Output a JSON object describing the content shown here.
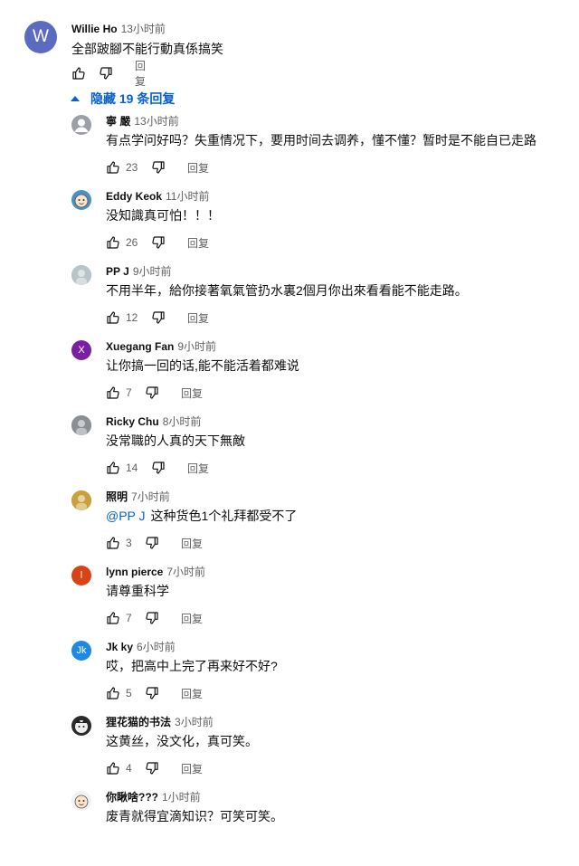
{
  "top_comment": {
    "avatar_letter": "W",
    "author": "Willie Ho",
    "time": "13小时前",
    "text": "全部跛腳不能行動真係搞笑",
    "reply_label": "回复"
  },
  "replies_toggle": "隐藏 19 条回复",
  "replies": [
    {
      "author": "寧 嚴",
      "time": "13小时前",
      "text": "有点学问好吗？失重情况下，要用时间去调养，懂不懂？暂时是不能自已走路",
      "likes": "23",
      "reply_label": "回复",
      "avatar": "default-person-avatar",
      "avatar_color": "#9aa0a6"
    },
    {
      "author": "Eddy Keok",
      "time": "11小时前",
      "text": "没知識真可怕！！！",
      "likes": "26",
      "reply_label": "回复",
      "avatar": "cartoon-face-avatar",
      "avatar_color": "#4a90c2"
    },
    {
      "author": "PP J",
      "time": "9小时前",
      "text": "不用半年，給你接著氧氣管扔水裏2個月你出來看看能不能走路。",
      "likes": "12",
      "reply_label": "回复",
      "avatar": "photo-avatar",
      "avatar_color": "#b8c4c8"
    },
    {
      "author": "Xuegang Fan",
      "time": "9小时前",
      "text": "让你搞一回的话,能不能活着都难说",
      "likes": "7",
      "reply_label": "回复",
      "avatar_letter": "X",
      "avatar_color": "#7b1fa2"
    },
    {
      "author": "Ricky Chu",
      "time": "8小时前",
      "text": "没常職的人真的天下無敵",
      "likes": "14",
      "reply_label": "回复",
      "avatar": "photo-avatar",
      "avatar_color": "#8a8f94"
    },
    {
      "author": "照明",
      "time": "7小时前",
      "mention": "@PP J",
      "text": "这种货色1个礼拜都受不了",
      "likes": "3",
      "reply_label": "回复",
      "avatar": "photo-avatar",
      "avatar_color": "#c9a13a"
    },
    {
      "author": "lynn pierce",
      "time": "7小时前",
      "text": "请尊重科学",
      "likes": "7",
      "reply_label": "回复",
      "avatar_letter": "l",
      "avatar_color": "#d84315"
    },
    {
      "author": "Jk ky",
      "time": "6小时前",
      "text": "哎，把高中上完了再来好不好?",
      "likes": "5",
      "reply_label": "回复",
      "avatar_letter": "Jk",
      "avatar_color": "#1e88e5"
    },
    {
      "author": "狸花猫的书法",
      "time": "3小时前",
      "text": "这黄丝，没文化，真可笑。",
      "likes": "4",
      "reply_label": "回复",
      "avatar": "cat-photo-avatar",
      "avatar_color": "#2b2b2b"
    },
    {
      "author": "你瞅啥???",
      "time": "1小时前",
      "text": "废青就得宜滴知识？可笑可笑。",
      "likes": "",
      "reply_label": "",
      "avatar": "cartoon-face-avatar",
      "avatar_color": "#f2f2f2"
    }
  ]
}
